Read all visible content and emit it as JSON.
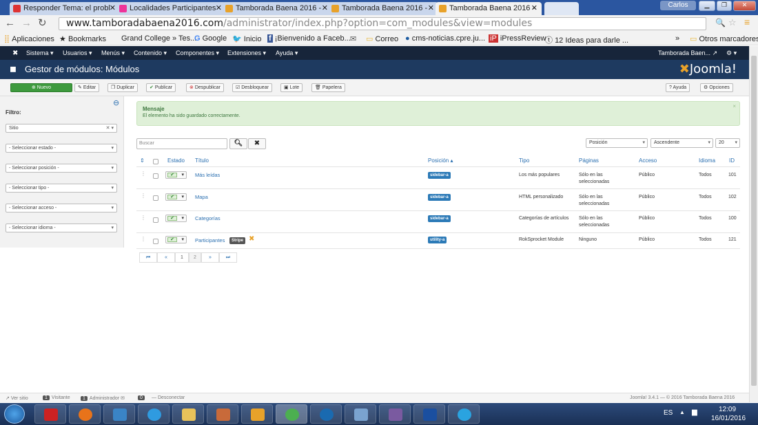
{
  "browser": {
    "tabs": [
      {
        "title": "Responder Tema: el probl",
        "active": false
      },
      {
        "title": "Localidades Participantes",
        "active": false
      },
      {
        "title": "Tamborada Baena 2016 -",
        "active": false
      },
      {
        "title": "Tamborada Baena 2016 -",
        "active": false
      },
      {
        "title": "Tamborada Baena 2016 -",
        "active": true
      }
    ],
    "user": "Carlos",
    "url_domain": "www.tamboradabaena2016.com",
    "url_path": "/administrator/index.php?option=com_modules&view=modules",
    "bookmarks": [
      "Aplicaciones",
      "Bookmarks",
      "Grand College » Tes...",
      "Google",
      "Inicio",
      "¡Bienvenido a Faceb...",
      "Correo",
      "cms-noticias.cpre.ju...",
      "iPressReview",
      "12 Ideas para darle ...",
      "»",
      "Otros marcadores"
    ]
  },
  "joomla": {
    "menu": [
      "Sistema ▾",
      "Usuarios ▾",
      "Menús ▾",
      "Contenido ▾",
      "Componentes ▾",
      "Extensiones ▾",
      "Ayuda ▾"
    ],
    "site_name": "Tamborada Baen...",
    "page_title": "Gestor de módulos: Módulos",
    "logo": "Joomla!",
    "toolbar": {
      "new": "Nuevo",
      "edit": "Editar",
      "duplicate": "Duplicar",
      "publish": "Publicar",
      "unpublish": "Despublicar",
      "unlock": "Desbloquear",
      "batch": "Lote",
      "trash": "Papelera",
      "help": "Ayuda",
      "options": "Opciones"
    },
    "filters": {
      "label": "Filtro:",
      "site": "Sitio",
      "status": "- Seleccionar estado -",
      "position": "- Seleccionar posición -",
      "type": "- Seleccionar tipo -",
      "access": "- Seleccionar acceso -",
      "language": "- Seleccionar idioma -"
    },
    "message": {
      "title": "Mensaje",
      "body": "El elemento ha sido guardado correctamente."
    },
    "search": {
      "placeholder": "Buscar"
    },
    "sort": {
      "field": "Posición",
      "direction": "Ascendente",
      "limit": "20"
    },
    "columns": {
      "status": "Estado",
      "title": "Título",
      "position": "Posición ▴",
      "type": "Tipo",
      "pages": "Páginas",
      "access": "Acceso",
      "language": "Idioma",
      "id": "ID"
    },
    "rows": [
      {
        "title": "Más leídas",
        "position": "sidebar-a",
        "type": "Los más populares",
        "pages1": "Sólo en las",
        "pages2": "seleccionadas",
        "access": "Público",
        "language": "Todos",
        "id": "101"
      },
      {
        "title": "Mapa",
        "position": "sidebar-a",
        "type": "HTML personalizado",
        "pages1": "Sólo en las",
        "pages2": "seleccionadas",
        "access": "Público",
        "language": "Todos",
        "id": "102"
      },
      {
        "title": "Categorías",
        "position": "sidebar-a",
        "type": "Categorías de artículos",
        "pages1": "Sólo en las",
        "pages2": "seleccionadas",
        "access": "Público",
        "language": "Todos",
        "id": "100"
      },
      {
        "title": "Participantes",
        "tag": "Stripe",
        "position": "utility-a",
        "type": "RokSprocket Module",
        "pages1": "Ninguno",
        "pages2": "",
        "access": "Público",
        "language": "Todos",
        "id": "121"
      }
    ],
    "pagination": [
      "⏮",
      "«",
      "1",
      "2",
      "»",
      "⏭"
    ],
    "footer": {
      "view_site": "Ver sitio",
      "visitors_count": "1",
      "visitors": "Visitante",
      "admins_count": "1",
      "admins": "Administrador",
      "messages_count": "0",
      "logout": "Desconectar",
      "version": "Joomla! 3.4.1 — © 2016 Tamborada Baena 2016"
    }
  },
  "taskbar": {
    "lang": "ES",
    "time": "12:09",
    "date": "16/01/2016"
  },
  "colors": {
    "joomla_nav": "#17253a",
    "joomla_header": "#1e3a60",
    "success": "#dff0d8",
    "link": "#2a6fb0",
    "new_button": "#3e9a3e"
  }
}
